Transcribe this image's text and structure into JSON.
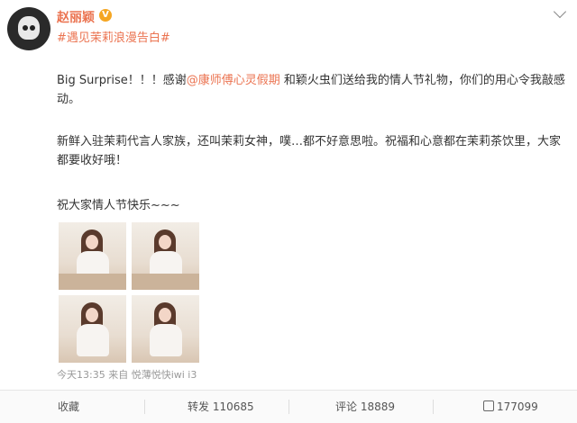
{
  "user": {
    "name": "赵丽颖",
    "verified_badge": "V",
    "topic": "#遇见茉莉浪漫告白#"
  },
  "post": {
    "line1_a": "Big Surprise！！！感谢",
    "line1_mention": "@康师傅心灵假期",
    "line1_b": " 和颖火虫们送给我的情人节礼物，你们的用心令我敲感",
    "line1_c": "动。",
    "para2": "新鲜入驻茉莉代言人家族，还叫茉莉女神，噗…都不好意思啦。祝福和心意都在茉莉茶饮里，大家都要收好哦！",
    "para3": "祝大家情人节快乐~~~"
  },
  "images": [
    {
      "alt": "photo-1"
    },
    {
      "alt": "photo-2"
    },
    {
      "alt": "photo-3"
    },
    {
      "alt": "photo-4"
    }
  ],
  "meta": {
    "time_source": "今天13:35 来自 悦薄悦快iwi i3"
  },
  "actions": {
    "favorite": "收藏",
    "repost": "转发 110685",
    "comment": "评论 18889",
    "like": "177099"
  },
  "colors": {
    "accent": "#eb7350",
    "text": "#333333",
    "muted": "#999999"
  },
  "icons": [
    "chevron-down-icon",
    "verified-badge-icon",
    "like-thumb-icon"
  ]
}
